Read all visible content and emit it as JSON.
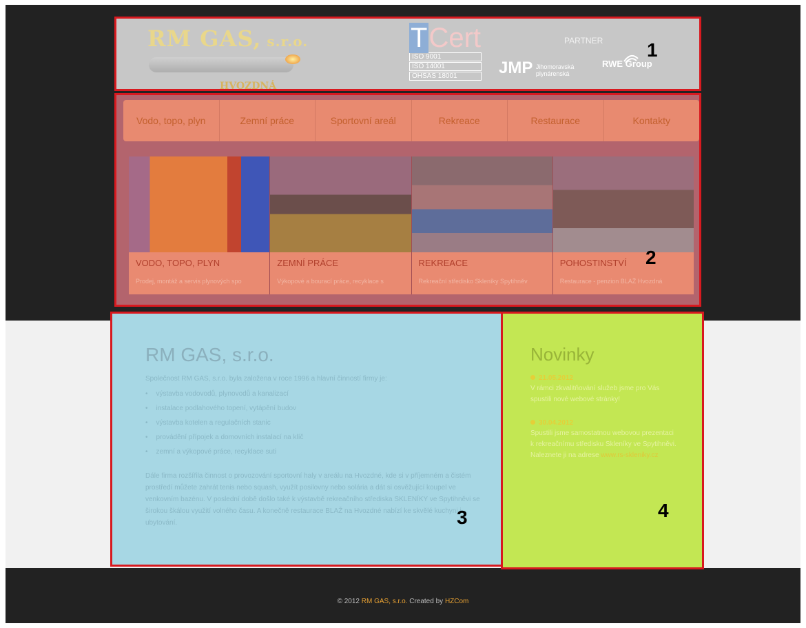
{
  "header": {
    "brand_name": "RM  GAS,",
    "brand_suffix": " s.r.o.",
    "brand_town": "HVOZDNÁ",
    "cert_t": "T",
    "cert_rest": "Cert",
    "iso": [
      "ISO 9001",
      "ISO 14001",
      "OHSAS 18001"
    ],
    "partner_label": "PARTNER",
    "jmp_big": "JMP",
    "jmp_small_1": "Jihomoravská",
    "jmp_small_2": "plynárenská",
    "rwe_label": "RWE",
    "rwe_group": "Group"
  },
  "nav": {
    "items": [
      "Vodo, topo, plyn",
      "Zemní práce",
      "Sportovní areál",
      "Rekreace",
      "Restaurace",
      "Kontakty"
    ]
  },
  "slides": [
    {
      "title": "VODO, TOPO, PLYN",
      "desc": "Prodej, montáž a servis plynových spo"
    },
    {
      "title": "ZEMNÍ PRÁCE",
      "desc": "Výkopové a bourací práce, recyklace s"
    },
    {
      "title": "REKREACE",
      "desc": "Rekreační středisko Skleníky Spytihněv"
    },
    {
      "title": "POHOSTINSTVÍ",
      "desc": "Restaurace - penzion BLAŽ Hvozdná"
    }
  ],
  "main": {
    "title": "RM GAS, s.r.o.",
    "intro": "Společnost RM GAS, s.r.o. byla založena v roce 1996 a hlavní činností firmy je:",
    "list": [
      "výstavba vodovodů, plynovodů a kanalizací",
      "instalace podlahového topení, vytápění budov",
      "výstavba kotelen a regulačních stanic",
      "provádění přípojek a domovních instalací na klíč",
      "zemní a výkopové práce, recyklace suti"
    ],
    "para": "Dále firma rozšířila činnost o provozování sportovní haly v areálu na Hvozdné, kde si v příjemném a čistém prostředí můžete zahrát tenis nebo squash, využít posilovny nebo solária a dát si osvěžující koupel ve venkovním bazénu. V poslední době došlo také k výstavbě rekreačního střediska SKLENÍKY ve Spytihněvi se širokou škálou využití volného času. A konečně restaurace BLAŽ na Hvozdné nabízí ke skvělé kuchyni i ubytování."
  },
  "news": {
    "title": "Novinky",
    "items": [
      {
        "date": "21.05.2012",
        "text": "V rámci zkvalitňování služeb jsme pro Vás spustili nové webové stránky!"
      },
      {
        "date": "30.04.2012",
        "text": "Spustili jsme samostatnou webovou prezentaci k rekreačnímu středisku Skleníky ve Spytihněvi. Naleznete ji na adrese",
        "link": "www.rs-skleniky.cz"
      }
    ]
  },
  "labels": [
    "1",
    "2",
    "3",
    "4"
  ],
  "footer": {
    "prefix": "© 2012 ",
    "company": "RM GAS, s.r.o.",
    "created": " Created by ",
    "author": "HZCom"
  }
}
